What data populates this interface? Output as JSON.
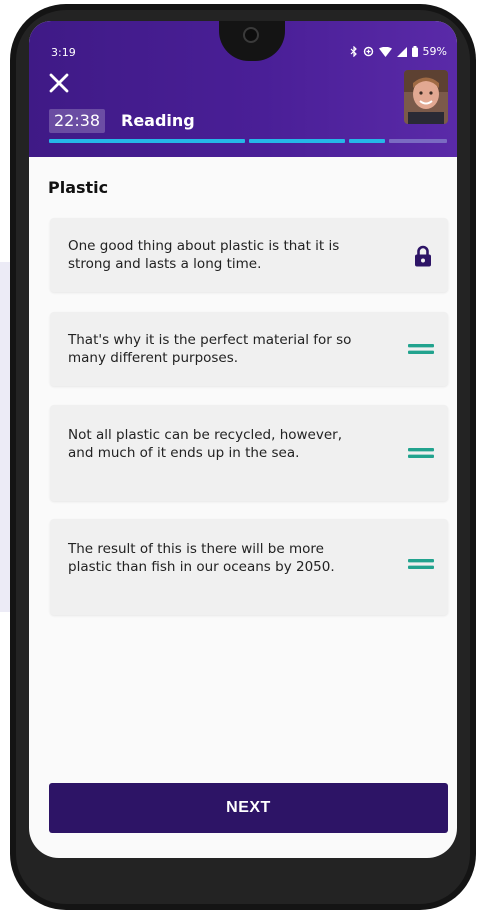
{
  "status_bar": {
    "time": "3:19",
    "icons": [
      "bluetooth-icon",
      "data-saver-icon",
      "wifi-icon",
      "signal-icon",
      "battery-icon"
    ],
    "battery": "59%"
  },
  "header": {
    "close_icon": "close-icon",
    "timer": "22:38",
    "section": "Reading",
    "progress_segments": [
      {
        "state": "done",
        "color": "#25b7e8"
      },
      {
        "state": "done",
        "color": "#25b7e8"
      },
      {
        "state": "current",
        "color": "#25b7e8"
      },
      {
        "state": "remaining",
        "color": "#7a6bc2"
      }
    ]
  },
  "task": {
    "title": "Plastic",
    "items": [
      {
        "text": "One good thing about plastic is that it is strong and lasts a long time.",
        "locked": true
      },
      {
        "text": "That's why it is the perfect material for so many different purposes.",
        "locked": false
      },
      {
        "text": "Not all plastic can be recycled, however, and much of it ends up in the sea.",
        "locked": false
      },
      {
        "text": "The result of this is there will be more plastic than fish in our oceans by 2050.",
        "locked": false
      }
    ]
  },
  "footer": {
    "next_label": "NEXT"
  },
  "colors": {
    "header_bg": "#42198c",
    "button_bg": "#2d1466",
    "accent_cyan": "#25b7e8",
    "drag_handle": "#22a38e",
    "lock": "#2d1466"
  }
}
